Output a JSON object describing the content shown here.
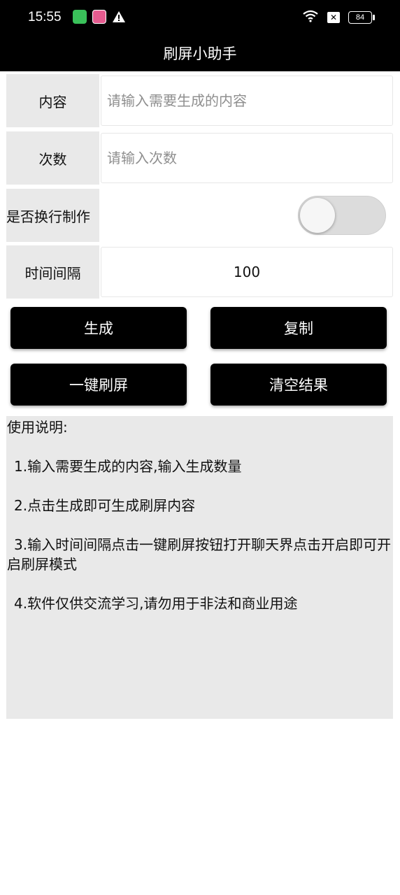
{
  "status_bar": {
    "time": "15:55",
    "battery": "84",
    "sim_label": "✕"
  },
  "title": "刷屏小助手",
  "form": {
    "content": {
      "label": "内容",
      "placeholder": "请输入需要生成的内容",
      "value": ""
    },
    "count": {
      "label": "次数",
      "placeholder": "请输入次数",
      "value": ""
    },
    "newline": {
      "label": "是否换行制作",
      "enabled": false
    },
    "interval": {
      "label": "时间间隔",
      "value": "100"
    }
  },
  "buttons": {
    "generate": "生成",
    "copy": "复制",
    "one_click": "一键刷屏",
    "clear": "清空结果"
  },
  "instructions": {
    "title": "使用说明:",
    "items": [
      " 1.输入需要生成的内容,输入生成数量",
      " 2.点击生成即可生成刷屏内容",
      " 3.输入时间间隔点击一键刷屏按钮打开聊天界点击开启即可开启刷屏模式",
      " 4.软件仅供交流学习,请勿用于非法和商业用途"
    ]
  },
  "colors": {
    "bar": "#000000",
    "label_bg": "#e9e9e9",
    "button_bg": "#000000",
    "toggle_track": "#dcdcdc"
  }
}
